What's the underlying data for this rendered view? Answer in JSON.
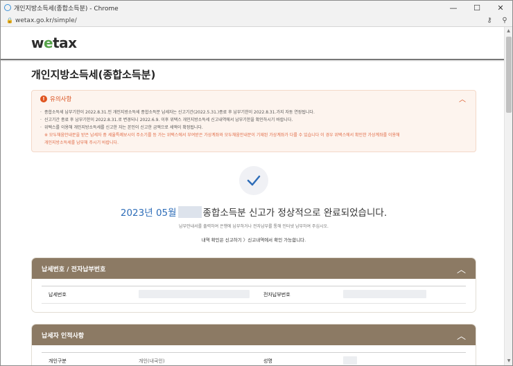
{
  "browser": {
    "window_title": "개인지방소득세(종합소득분) - Chrome",
    "url": "wetax.go.kr/simple/",
    "controls": {
      "minimize": "—",
      "maximize": "☐",
      "close": "✕"
    },
    "icons": {
      "lock": "lock-icon",
      "key": "key-icon",
      "zoom": "search-icon"
    }
  },
  "site": {
    "logo_prefix": "w",
    "logo_accent": "e",
    "logo_suffix": "tax",
    "accent_color": "#57a34a"
  },
  "page": {
    "title": "개인지방소득세(종합소득분)"
  },
  "notice": {
    "heading": "유의사항",
    "items": [
      "종합소득세 납부기한이 2022.8.31.인 개인지방소득세 종합소득분 납세자는 신고기간(2022.5.31.)종료 후 납부기한이 2022.8.31.가지 자동 연장됩니다.",
      "신고기간 종료 후 납부기한이 2022.8.31.로 변경되니 2022.6.9. 이후 위택스 개인지방소득세 신고내역에서 납부기한을 확인하시기 바랍니다.",
      "위택스를 이용해 개인지방소득세를 신고한 자는 본인이 신고한 금액으로 세액이 확정됩니다."
    ],
    "warning_lines": [
      "※ 모두채움안내문을 받은 납세자 중 세율특례보시이 주소기를 등 가는 위택스에서 부여받은 가상계좌와 모두채움안내문이 기재된 가상계좌가 다를 수 있습니다 이 경우 위택스에서 확인한 가상계좌를 이용해",
      "개인지방소득세를 납부해 주시기 바랍니다."
    ]
  },
  "completion": {
    "year_month": "2023년 05월",
    "message": "종합소득분 신고가 정상적으로 완료되었습니다.",
    "sub": "납부안내서를 출력하여 은행에 납부하거나 전자납부를 통해 인터넷 납부하여 주십시오.",
    "link_text": "내역 확인은 신고하기 〉신고내역에서 확인 가능합니다."
  },
  "panels": [
    {
      "title": "납세번호 / 전자납부번호",
      "fields": [
        {
          "label": "납세번호",
          "value": ""
        },
        {
          "label": "전자납부번호",
          "value": ""
        }
      ]
    },
    {
      "title": "납세자 인적사항",
      "fields": [
        {
          "label": "개인구분",
          "value": "개인(내국인)"
        },
        {
          "label": "성명",
          "value": ""
        }
      ]
    }
  ],
  "colors": {
    "panel_header": "#8c7a64",
    "notice_bg": "#fdf4ee",
    "warning": "#d9501e",
    "check": "#2e6db8"
  }
}
